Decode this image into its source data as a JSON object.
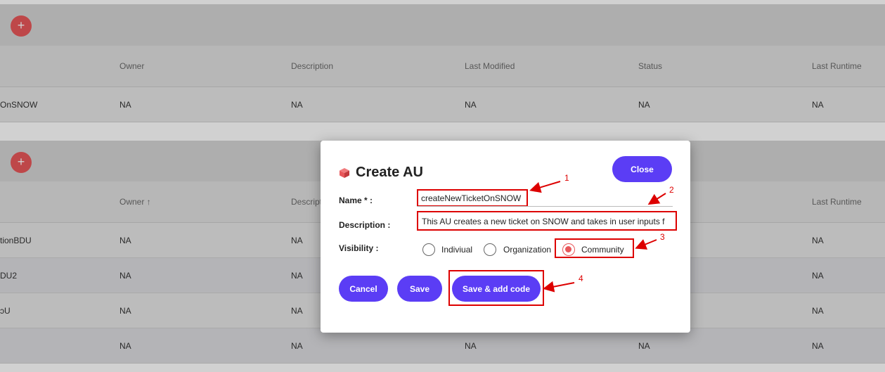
{
  "table1": {
    "add_label": "+",
    "headers": [
      "Owner",
      "Description",
      "Last Modified",
      "Status",
      "Last Runtime"
    ],
    "rows": [
      [
        "OnSNOW",
        "NA",
        "NA",
        "NA",
        "NA",
        "NA"
      ]
    ]
  },
  "table2": {
    "add_label": "+",
    "headers": [
      "Owner ↑",
      "Descript",
      "Last Runtime"
    ],
    "rows": [
      [
        "tionBDU",
        "NA",
        "NA",
        "NA"
      ],
      [
        "DU2",
        "NA",
        "NA",
        "NA"
      ],
      [
        "ɔU",
        "NA",
        "NA",
        "NA"
      ],
      [
        "",
        "NA",
        "NA",
        "NA",
        "NA",
        "NA"
      ]
    ]
  },
  "modal": {
    "title": "Create AU",
    "close_label": "Close",
    "name_label": "Name * :",
    "name_value": "createNewTicketOnSNOW",
    "description_label": "Description :",
    "description_value": "This AU creates a new ticket on SNOW and takes in user inputs f",
    "visibility_label": "Visibility :",
    "visibility_options": [
      "Indiviual",
      "Organization",
      "Community"
    ],
    "visibility_selected": "Community",
    "cancel_label": "Cancel",
    "save_label": "Save",
    "save_code_label": "Save & add code"
  },
  "annotations": [
    "1",
    "2",
    "3",
    "4"
  ],
  "colors": {
    "accent": "#5b3df5",
    "add_button": "#e8575a",
    "annotation": "#dd0000"
  }
}
